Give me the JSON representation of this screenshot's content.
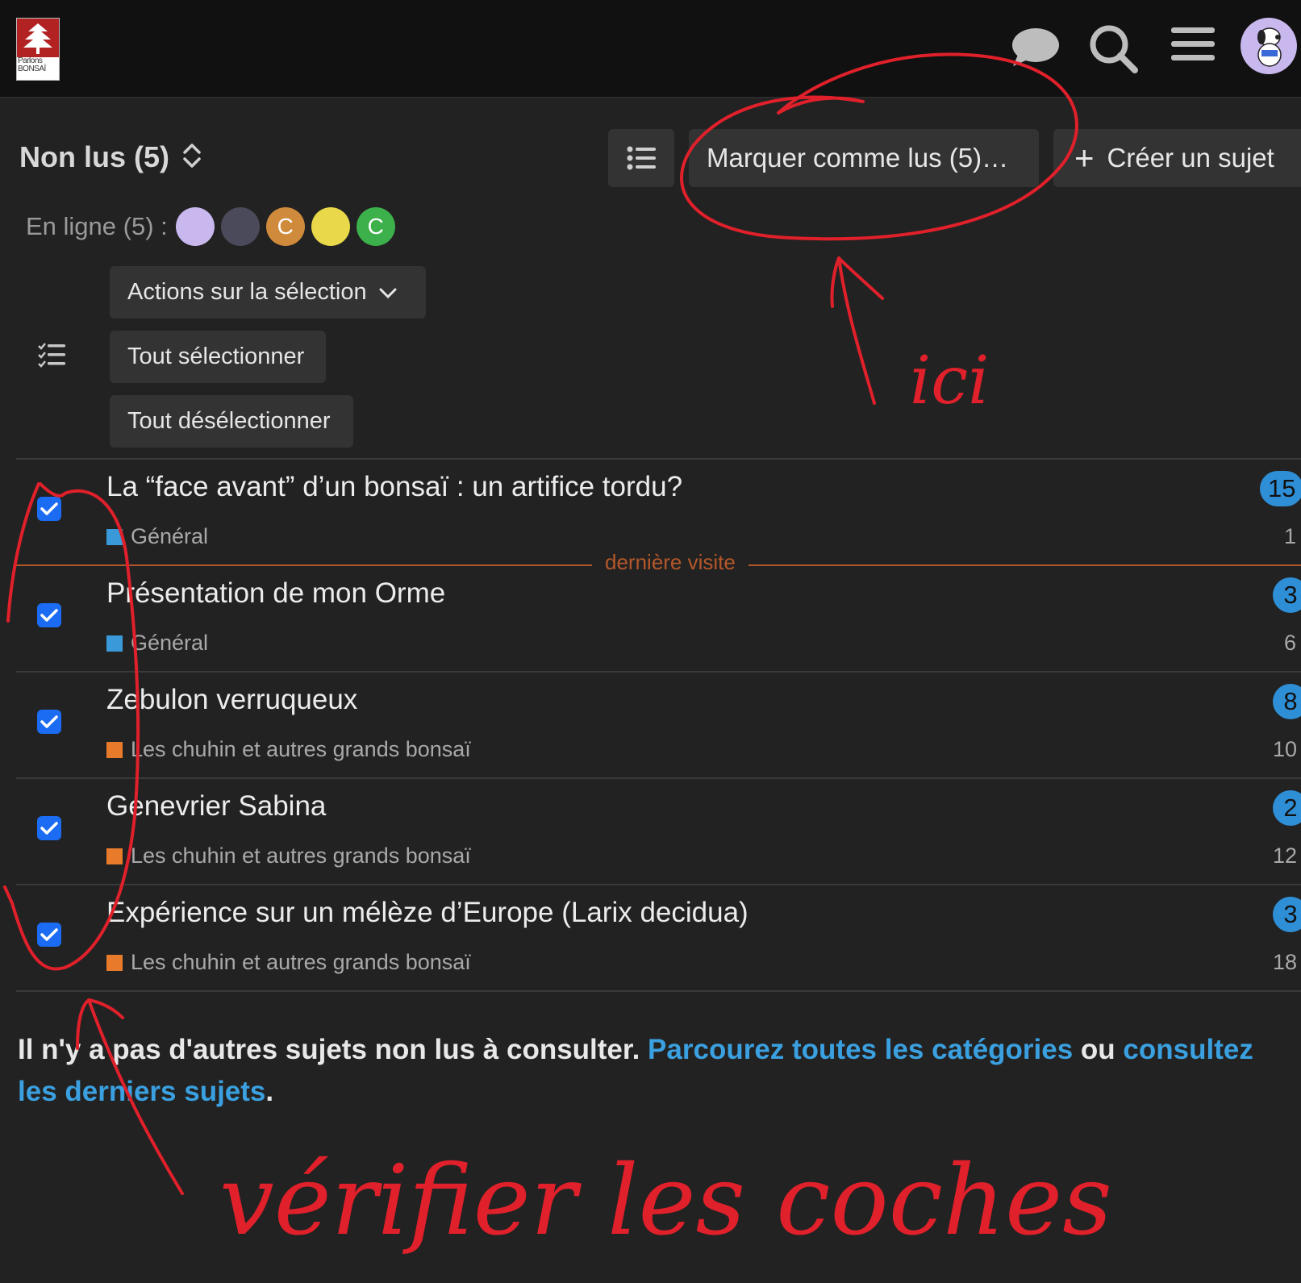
{
  "header": {
    "logo_text": "Parlons BONSAÏ",
    "icons": [
      "chat-icon",
      "search-icon",
      "hamburger-menu-icon",
      "user-avatar"
    ]
  },
  "controls": {
    "title": "Non lus (5)",
    "mark_read": "Marquer comme lus (5)…",
    "create_topic": "Créer un sujet",
    "online_label": "En ligne (5) :",
    "online_users": [
      {
        "letter": "",
        "color": "#c9b8ee"
      },
      {
        "letter": "",
        "color": "#4a4a5a"
      },
      {
        "letter": "C",
        "color": "#d08a3c"
      },
      {
        "letter": "",
        "color": "#e8d84a"
      },
      {
        "letter": "C",
        "color": "#3cb04a"
      }
    ],
    "actions": "Actions sur la sélection",
    "select_all": "Tout sélectionner",
    "deselect_all": "Tout désélectionner"
  },
  "topics": [
    {
      "title": "La “face avant” d’un bonsaï : un artifice tordu?",
      "category": "Général",
      "cat_color": "#3a9ad9",
      "count": "15",
      "activity": "1"
    },
    {
      "title": "Présentation de mon Orme",
      "category": "Général",
      "cat_color": "#3a9ad9",
      "count": "3",
      "activity": "6"
    },
    {
      "title": "Zebulon verruqueux",
      "category": "Les chuhin et autres grands bonsaï",
      "cat_color": "#e87a2c",
      "count": "8",
      "activity": "10"
    },
    {
      "title": "Genevrier Sabina",
      "category": "Les chuhin et autres grands bonsaï",
      "cat_color": "#e87a2c",
      "count": "2",
      "activity": "12"
    },
    {
      "title": "Expérience sur un mélèze d’Europe (Larix decidua)",
      "category": "Les chuhin et autres grands bonsaï",
      "cat_color": "#e87a2c",
      "count": "3",
      "activity": "18"
    }
  ],
  "last_visit_label": "dernière visite",
  "footer": {
    "text_before": "Il n'y a pas d'autres sujets non lus à consulter. ",
    "link1": "Parcourez toutes les catégories",
    "middle": " ou ",
    "link2": "consultez les derniers sujets",
    "end": "."
  },
  "annotations": {
    "arrow_label": "ici",
    "bottom_label": "vérifier les coches",
    "ink_color": "#e0202a"
  }
}
